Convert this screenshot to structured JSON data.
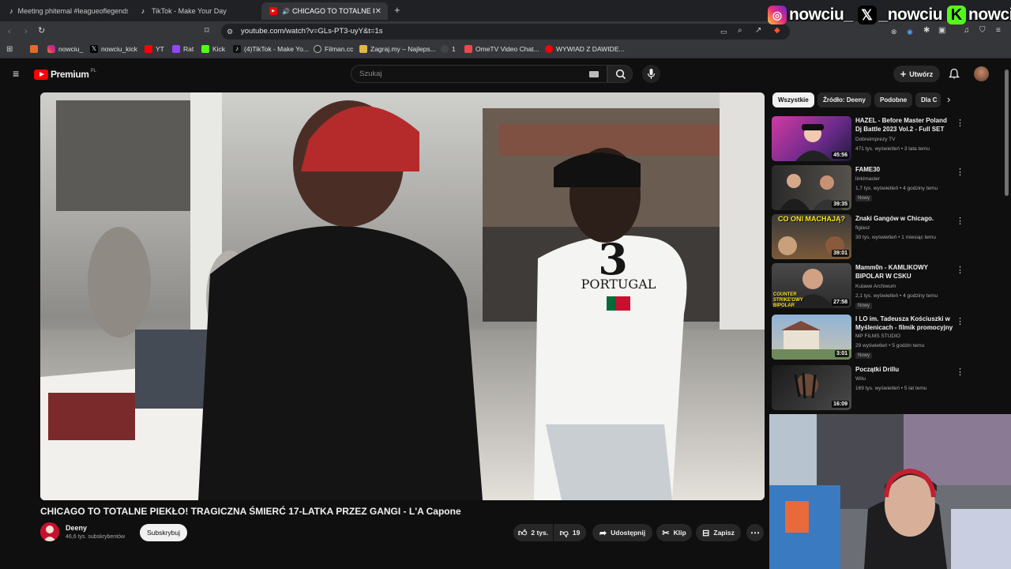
{
  "browser": {
    "tabs": [
      {
        "title": "Meeting phitemal #leagueoflegends"
      },
      {
        "title": "TikTok - Make Your Day"
      },
      {
        "title": "CHICAGO TO TOTALNE PIEKŁO"
      }
    ],
    "url": "youtube.com/watch?v=GLs-PT3-uyY&t=1s",
    "bookmarks": [
      {
        "label": "nowciu_"
      },
      {
        "label": "nowciu_kick"
      },
      {
        "label": "YT"
      },
      {
        "label": "Rat"
      },
      {
        "label": "Kick"
      },
      {
        "label": "(4)TikTok - Make Yo..."
      },
      {
        "label": "Filman.cc"
      },
      {
        "label": "Zagraj.my – Najleps..."
      },
      {
        "label": "1"
      },
      {
        "label": "OmeTV Video Chat..."
      },
      {
        "label": "WYWIAD Z DAWIDE..."
      }
    ]
  },
  "overlay": {
    "instagram": "nowciu_",
    "x": "_nowciu",
    "kick": "nowciu"
  },
  "youtube": {
    "logo_text": "Premium",
    "region": "PL",
    "search_placeholder": "Szukaj",
    "create_label": "Utwórz"
  },
  "video": {
    "jersey_number": "3",
    "jersey_text": "PORTUGAL",
    "title": "CHICAGO TO TOTALNE PIEKŁO! TRAGICZNA ŚMIERĆ 17-LATKA PRZEZ GANGI - L'A Capone",
    "channel": "Deeny",
    "subscribers": "46,6 tys. subskrybentów",
    "subscribe_label": "Subskrybuj",
    "likes": "2 tys.",
    "dislikes": "19",
    "share_label": "Udostępnij",
    "clip_label": "Klip",
    "save_label": "Zapisz"
  },
  "sidebar": {
    "chips": [
      "Wszystkie",
      "Źródło: Deeny",
      "Podobne",
      "Dla C"
    ],
    "recs": [
      {
        "title": "HAZEL - Before Master Poland Dj Battle 2023 Vol.2 - Full SET",
        "channel": "Dobreimprezy TV",
        "meta": "471 tys. wyświetleń • 3 lata temu",
        "duration": "45:56",
        "badge": ""
      },
      {
        "title": "FAME30",
        "channel": "linkimaster",
        "meta": "1,7 tys. wyświetleń • 4 godziny temu",
        "duration": "39:35",
        "badge": "Nowy"
      },
      {
        "title": "Znaki Gangów w Chicago.",
        "channel": "figlasz",
        "meta": "30 tys. wyświetleń • 1 miesiąc temu",
        "duration": "39:01",
        "badge": "",
        "thumb_text": "CO ONI MACHAJĄ?"
      },
      {
        "title": "Mamm0n - KAMLIKOWY BIPOLAR W CSKU",
        "channel": "Kulawe Archiwum",
        "meta": "2,1 tys. wyświetleń • 4 godziny temu",
        "duration": "27:58",
        "badge": "Nowy",
        "thumb_text": "COUNTER STRIKE'OWY BIPOLAR"
      },
      {
        "title": "I LO im. Tadeusza Kościuszki w Myślenicach - filmik promocyjny",
        "channel": "MP FILMS STUDIO",
        "meta": "29 wyświetleń • 5 godzin temu",
        "duration": "3:01",
        "badge": "Nowy"
      },
      {
        "title": "Początki Drillu",
        "channel": "Witu",
        "meta": "169 tys. wyświetleń • 5 lat temu",
        "duration": "16:09",
        "badge": ""
      }
    ]
  },
  "colors": {
    "accent": "#ff0000",
    "background": "#0f0f0f",
    "kick_green": "#53fc18"
  }
}
